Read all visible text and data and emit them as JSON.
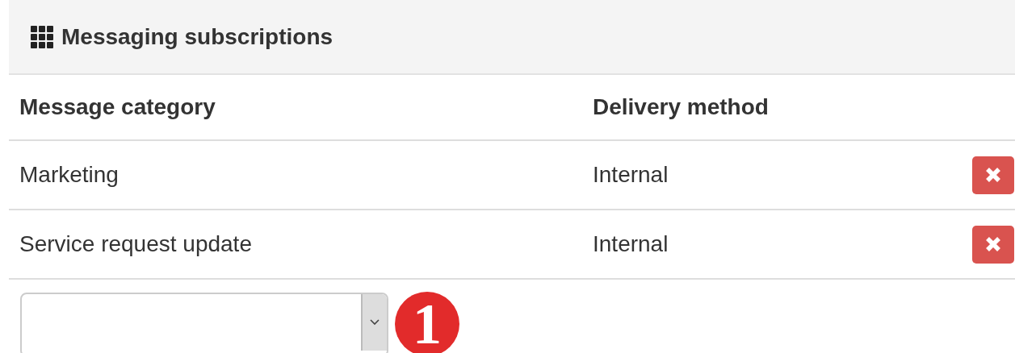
{
  "panel": {
    "title": "Messaging subscriptions"
  },
  "table": {
    "columns": [
      "Message category",
      "Delivery method"
    ],
    "rows": [
      {
        "category": "Marketing",
        "method": "Internal"
      },
      {
        "category": "Service request update",
        "method": "Internal"
      }
    ]
  },
  "new_subscription": {
    "callout": "1"
  }
}
